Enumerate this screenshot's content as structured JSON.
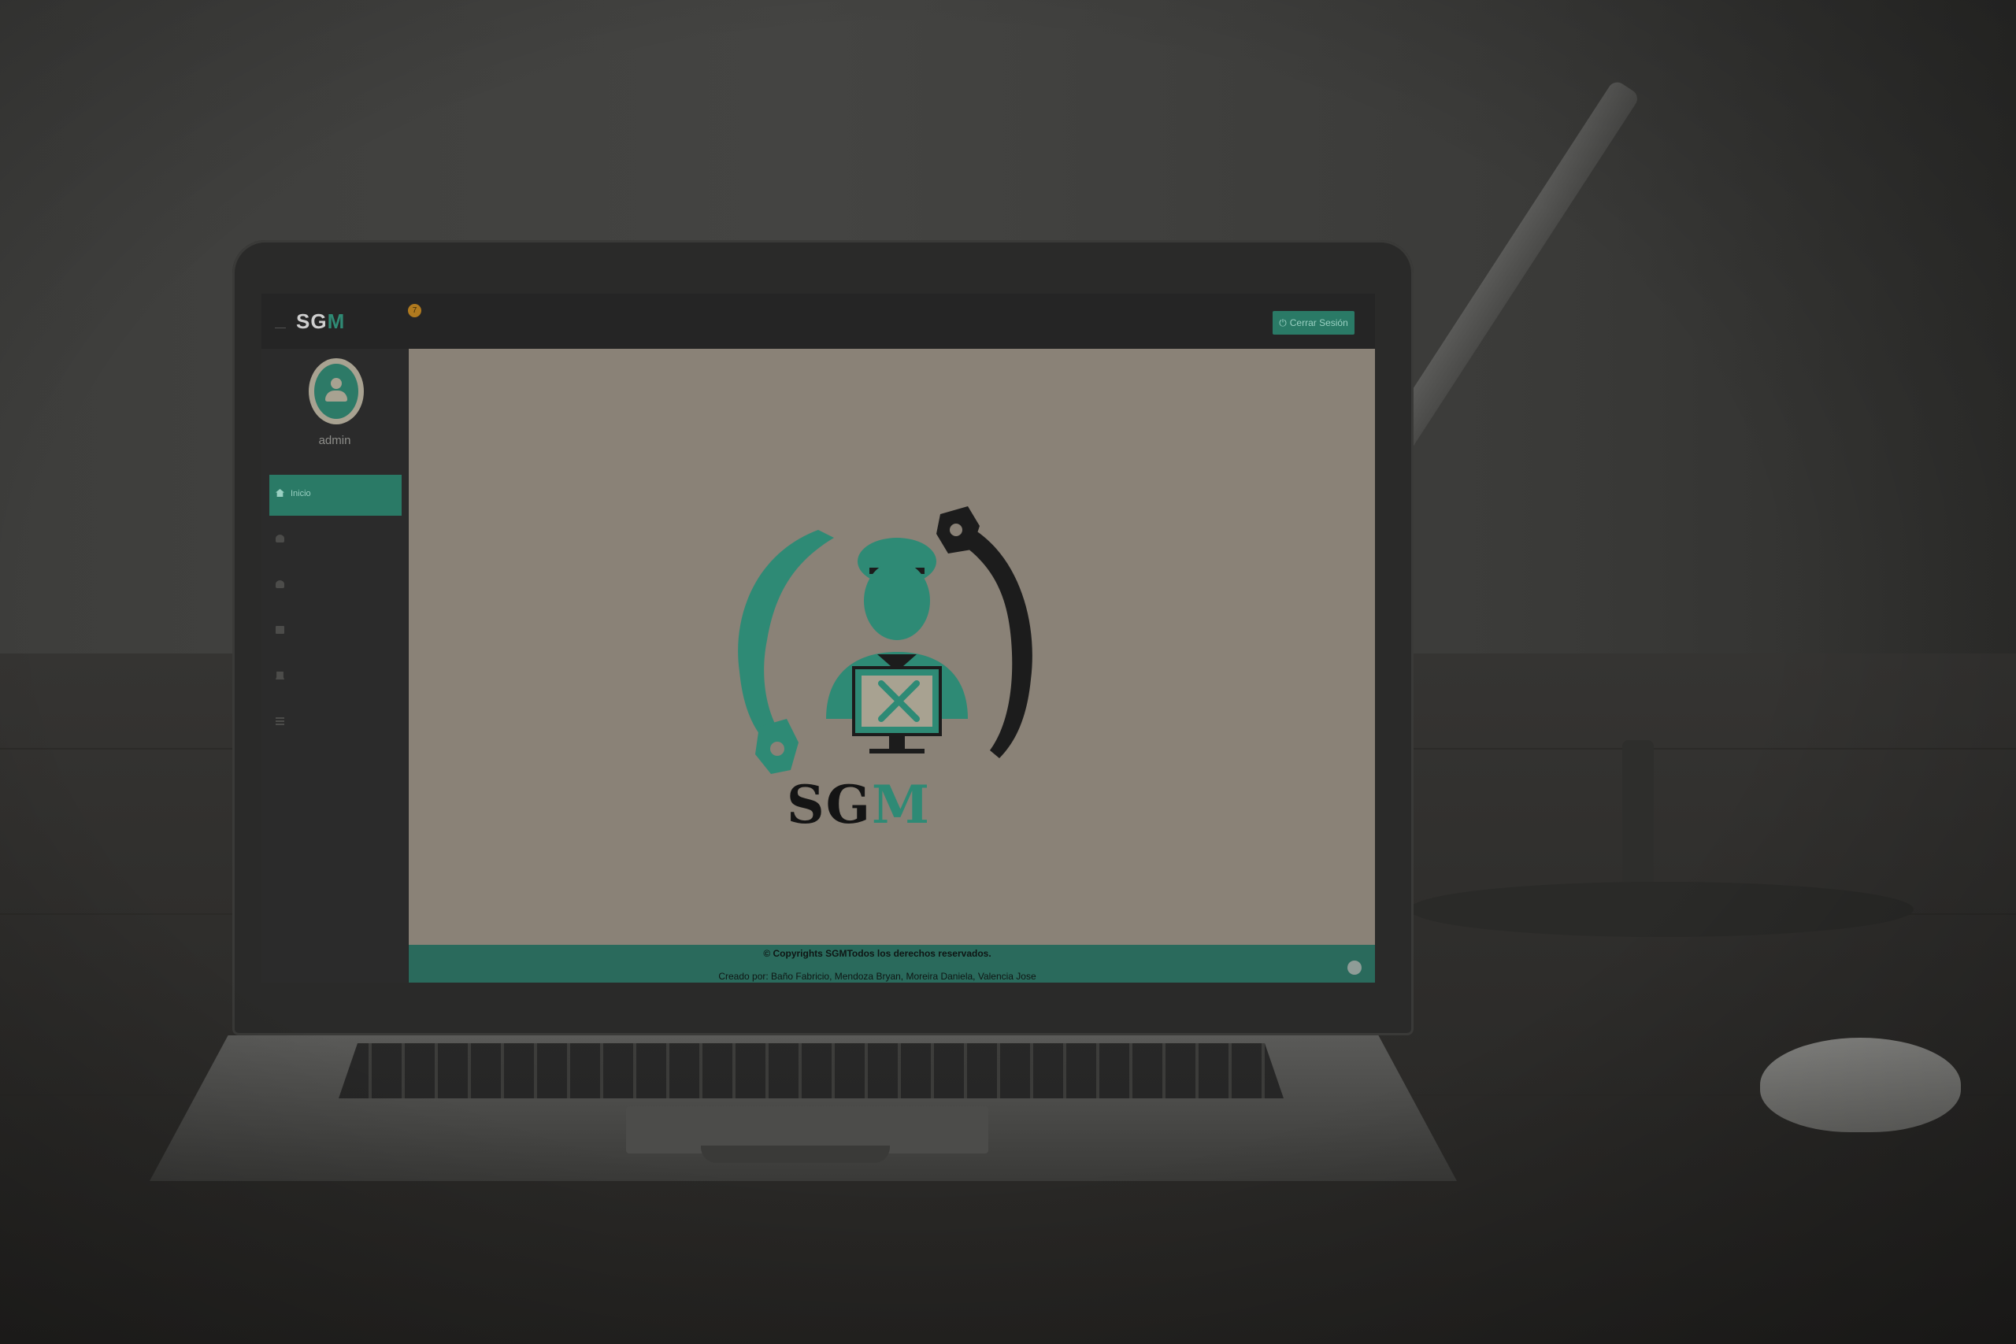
{
  "topbar": {
    "brand_sg": "SG",
    "brand_m": "M",
    "notification_count": "7",
    "logout_label": "Cerrar Sesión"
  },
  "sidebar": {
    "username": "admin",
    "items": [
      {
        "label": "Inicio",
        "icon": "home-icon",
        "active": true
      },
      {
        "label": "",
        "icon": "users-icon",
        "active": false
      },
      {
        "label": "",
        "icon": "users-icon",
        "active": false
      },
      {
        "label": "",
        "icon": "trash-icon",
        "active": false
      },
      {
        "label": "",
        "icon": "laptop-icon",
        "active": false
      },
      {
        "label": "",
        "icon": "list-icon",
        "active": false
      }
    ]
  },
  "main": {
    "logo_sg": "SG",
    "logo_m": "M"
  },
  "footer": {
    "copyright": "© Copyrights SGMTodos los derechos reservados.",
    "credits": "Creado por: Baño Fabricio, Mendoza Bryan, Moreira Daniela, Valencia Jose"
  },
  "colors": {
    "accent": "#2a7a66",
    "content_bg": "#8a8277",
    "sidebar_bg": "#2b2b2b",
    "topbar_bg": "#252525"
  }
}
